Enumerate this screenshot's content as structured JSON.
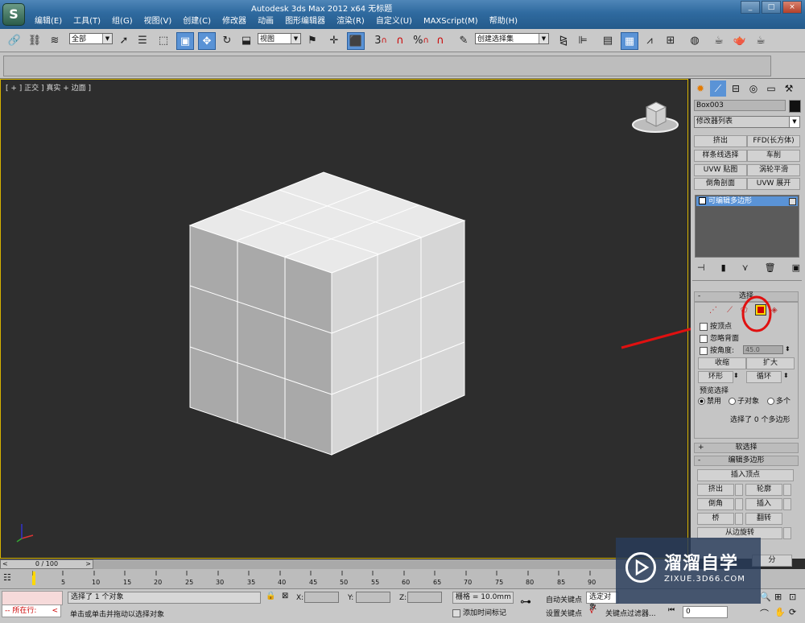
{
  "window": {
    "title": "Autodesk 3ds Max  2012 x64      无标题",
    "logo_letter": "S",
    "controls": [
      "_",
      "□",
      "×"
    ]
  },
  "menu": [
    "编辑(E)",
    "工具(T)",
    "组(G)",
    "视图(V)",
    "创建(C)",
    "修改器",
    "动画",
    "图形编辑器",
    "渲染(R)",
    "自定义(U)",
    "MAXScript(M)",
    "帮助(H)"
  ],
  "toolbar": {
    "selection_filter": "全部",
    "ref_coord": "视图",
    "named_selection": "创建选择集",
    "snap_label": "3",
    "percent_label": "%"
  },
  "viewport": {
    "label": "[ + ] 正交 ] 真实 + 边面 ]"
  },
  "command_panel": {
    "object_name": "Box003",
    "modifier_list": "修改器列表",
    "modifier_buttons": [
      [
        "挤出",
        "FFD(长方体)"
      ],
      [
        "样条线选择",
        "车削"
      ],
      [
        "UVW 贴图",
        "涡轮平滑"
      ],
      [
        "倒角剖面",
        "UVW 展开"
      ]
    ],
    "stack_item": "可编辑多边形",
    "selection_rollout": {
      "title": "选择",
      "by_vertex": "按顶点",
      "ignore_backfacing": "忽略背面",
      "by_angle": "按角度:",
      "angle_value": "45.0",
      "shrink": "收缩",
      "grow": "扩大",
      "ring": "环形",
      "loop": "循环",
      "preview_title": "预览选择",
      "preview_options": [
        "禁用",
        "子对象",
        "多个"
      ],
      "status": "选择了 0 个多边形"
    },
    "soft_selection": "软选择",
    "edit_polygons": {
      "title": "编辑多边形",
      "insert_vertex": "插入顶点",
      "buttons": [
        [
          "挤出",
          "轮廓"
        ],
        [
          "倒角",
          "插入"
        ],
        [
          "桥",
          "翻转"
        ]
      ],
      "hinge": "从边旋转",
      "extra": [
        "分",
        "旋转"
      ]
    }
  },
  "timeline": {
    "slider_label": "0 / 100",
    "ticks": [
      "5",
      "10",
      "15",
      "20",
      "25",
      "30",
      "35",
      "40",
      "45",
      "50",
      "55",
      "60",
      "65",
      "70",
      "75",
      "80",
      "85",
      "90"
    ]
  },
  "status": {
    "maxscript": "所在行:",
    "message1": "选择了 1 个对象",
    "message2": "单击或单击并拖动以选择对象",
    "x_label": "X:",
    "y_label": "Y:",
    "z_label": "Z:",
    "grid": "栅格 = 10.0mm",
    "add_time_tag": "添加时间标记",
    "auto_key": "自动关键点",
    "auto_key_value": "选定对象",
    "set_key": "设置关键点",
    "key_filters": "关键点过滤器...",
    "frame": "0"
  },
  "watermark": {
    "title": "溜溜自学",
    "url": "ZIXUE.3D66.COM"
  },
  "colors": {
    "viewport_bg": "#2d2d2d",
    "annotation_red": "#e01010",
    "highlight_yellow": "#ffd800",
    "title_blue": "#2f6a9f"
  }
}
